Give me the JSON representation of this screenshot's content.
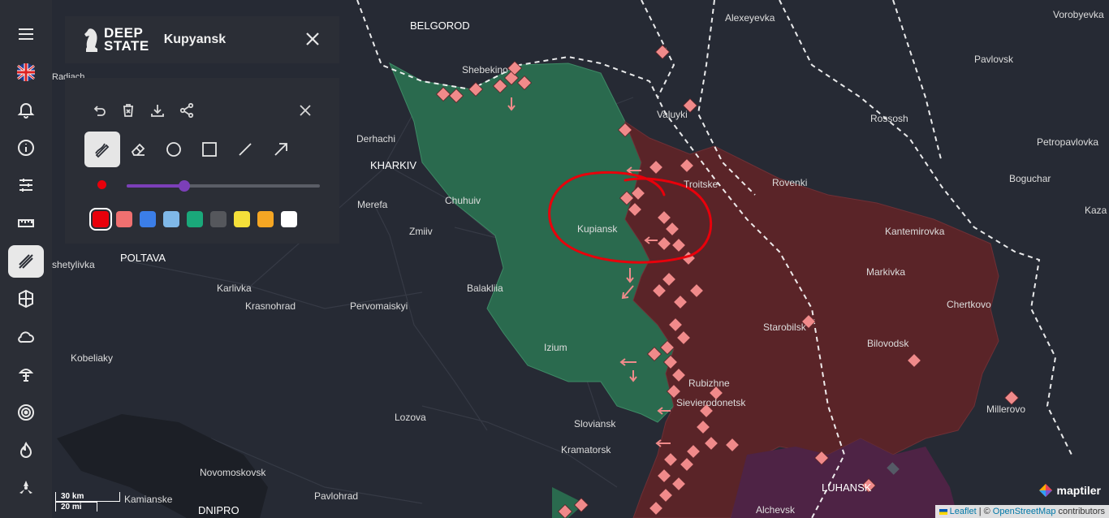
{
  "header": {
    "logo_text_1": "DEEP",
    "logo_text_2": "STATE",
    "title": "Kupyansk"
  },
  "rail_icons": [
    "menu-icon",
    "flag-uk-icon",
    "bell-icon",
    "info-icon",
    "sliders-icon",
    "ruler-icon",
    "draw-icon",
    "shield-icon",
    "cloud-icon",
    "explosion-icon",
    "target-icon",
    "fire-icon",
    "radiation-icon"
  ],
  "draw_panel": {
    "actions": [
      "undo-icon",
      "clear-icon",
      "download-icon",
      "share-icon"
    ],
    "tools": [
      "pen-icon",
      "eraser-icon",
      "circle-icon",
      "rectangle-icon",
      "line-icon",
      "arrow-icon"
    ],
    "active_tool": "pen-icon",
    "brush_size_fraction": 0.3,
    "colors": [
      "#e8000b",
      "#f07070",
      "#3b7ee8",
      "#7fb8e8",
      "#1aa87a",
      "#55575c",
      "#f5e03a",
      "#f5a623",
      "#ffffff"
    ],
    "selected_color": "#e8000b"
  },
  "map_labels": {
    "belgorod": "BELGOROD",
    "shebekino": "Shebekino",
    "alexeyevka": "Alexeyevka",
    "vorobyevka": "Vorobyevka",
    "pavlovsk": "Pavlovsk",
    "valuyki": "Valuyki",
    "rossosh": "Rossosh",
    "petropavlovka": "Petropavlovka",
    "derhachi": "Derhachi",
    "kharkiv": "KHARKIV",
    "troitske": "Troitske",
    "rovenki": "Rovenki",
    "boguchar": "Boguchar",
    "kaza": "Kaza",
    "merefa": "Merefa",
    "chuhuiv": "Chuhuiv",
    "kupiansk": "Kupiansk",
    "kantemirovka": "Kantemirovka",
    "zmiiv": "Zmiiv",
    "poltava": "POLTAVA",
    "shetylivka": "shetylivka",
    "markivka": "Markivka",
    "karlivka": "Karlivka",
    "balakliia": "Balakliia",
    "krasnohrad": "Krasnohrad",
    "pervomaiskyi": "Pervomaiskyi",
    "chertkovo": "Chertkovo",
    "starobilsk": "Starobilsk",
    "izium": "Izium",
    "bilovodsk": "Bilovodsk",
    "kobeliaky": "Kobeliaky",
    "rubizhne": "Rubizhne",
    "sievierodonetsk": "Sievierodonetsk",
    "millerovo": "Millerovo",
    "lozova": "Lozova",
    "sloviansk": "Sloviansk",
    "kramatorsk": "Kramatorsk",
    "novomoskovsk": "Novomoskovsk",
    "pavlohrad": "Pavlohrad",
    "kamianske": "Kamianske",
    "dnipro": "DNIPRO",
    "luhansk": "LUHANSK",
    "alchevsk": "Alchevsk",
    "radiach": "Radiach"
  },
  "scale": {
    "km": "30 km",
    "mi": "20 mi"
  },
  "attribution": {
    "leaflet": "Leaflet",
    "sep": "| ©",
    "osm": "OpenStreetMap",
    "contributors": "contributors"
  },
  "maptiler": "maptiler",
  "colors": {
    "background": "#262a34",
    "ukraine_controlled": "#2a6a4e",
    "occupied": "#5a2428",
    "crimea_dpr": "#4e2345",
    "marker": "#f08a8a",
    "annotation": "#e8000b"
  }
}
